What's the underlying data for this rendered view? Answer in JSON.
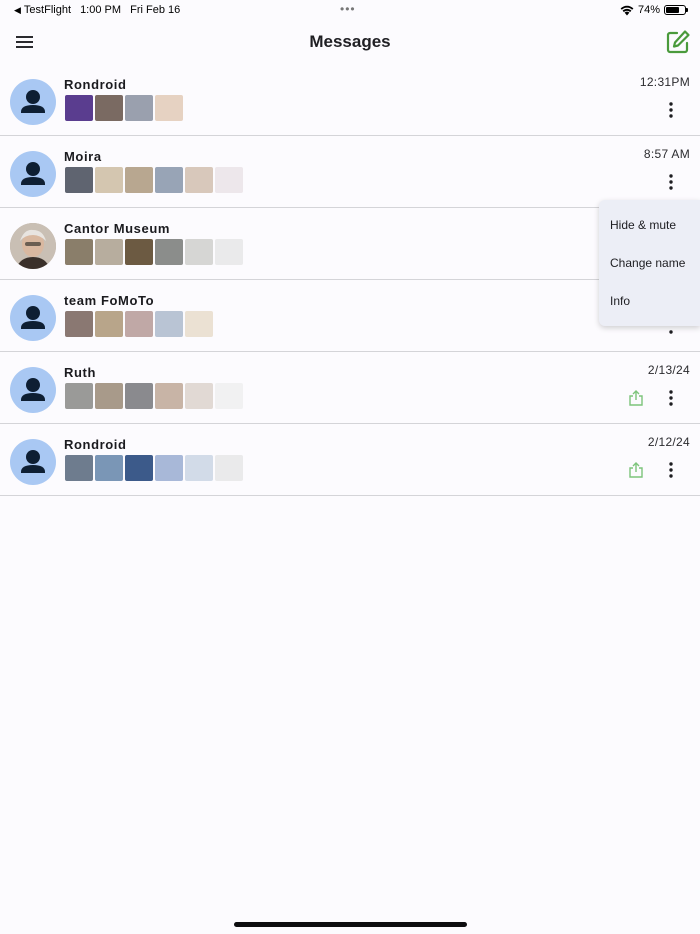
{
  "status_bar": {
    "back_app": "TestFlight",
    "time": "1:00 PM",
    "date": "Fri Feb 16",
    "multitasking_dots": "•••",
    "battery_percent": "74%",
    "battery_level": 0.74
  },
  "header": {
    "title": "Messages",
    "menu_icon": "hamburger-menu-icon",
    "compose_icon": "compose-edit-icon",
    "accent_color": "#4a9a3c"
  },
  "conversations": [
    {
      "name": "Rondroid",
      "time": "12:31PM",
      "avatar": "person-icon",
      "thumbnail_colors": [
        "#5a3d8f",
        "#7a6a62",
        "#9aa0ae",
        "#e6d2c2"
      ],
      "show_share": false
    },
    {
      "name": "Moira",
      "time": "8:57 AM",
      "avatar": "person-icon",
      "thumbnail_colors": [
        "#5f6470",
        "#d4c6b0",
        "#b8a790",
        "#98a4b6",
        "#ccb7a4",
        "#e8e0e4"
      ],
      "show_share": false
    },
    {
      "name": "Cantor Museum",
      "time": "",
      "avatar": "photo",
      "thumbnail_colors": [
        "#8a7e6a",
        "#b7ad9e",
        "#6c5a42",
        "#8b8d8b",
        "#c9c9c6",
        "#e4e4e4"
      ],
      "show_share": false
    },
    {
      "name": "team FoMoTo",
      "time": "",
      "avatar": "person-icon",
      "thumbnail_colors": [
        "#8a7872",
        "#b8a58a",
        "#c0a8a6",
        "#b9c4d4",
        "#e6d8c4"
      ],
      "show_share": false
    },
    {
      "name": "Ruth",
      "time": "2/13/24",
      "avatar": "person-icon",
      "thumbnail_colors": [
        "#9a9a98",
        "#a89a8a",
        "#8a8a8e",
        "#c8b4a6",
        "#d8cec6",
        "#eeeeee"
      ],
      "show_share": true
    },
    {
      "name": "Rondroid",
      "time": "2/12/24",
      "avatar": "person-icon",
      "thumbnail_colors": [
        "#6e7c8e",
        "#7a96b6",
        "#3c5a8a",
        "#a8b8d8",
        "#c4d0e0",
        "#e4e4e4"
      ],
      "show_share": true
    }
  ],
  "popup_menu": {
    "items": [
      "Hide & mute",
      "Change name",
      "Info"
    ]
  },
  "colors": {
    "avatar_bg": "#a9c8f3",
    "avatar_fg": "#0e1f33",
    "share_icon": "#7cc47a",
    "divider": "#d4d4d8"
  }
}
